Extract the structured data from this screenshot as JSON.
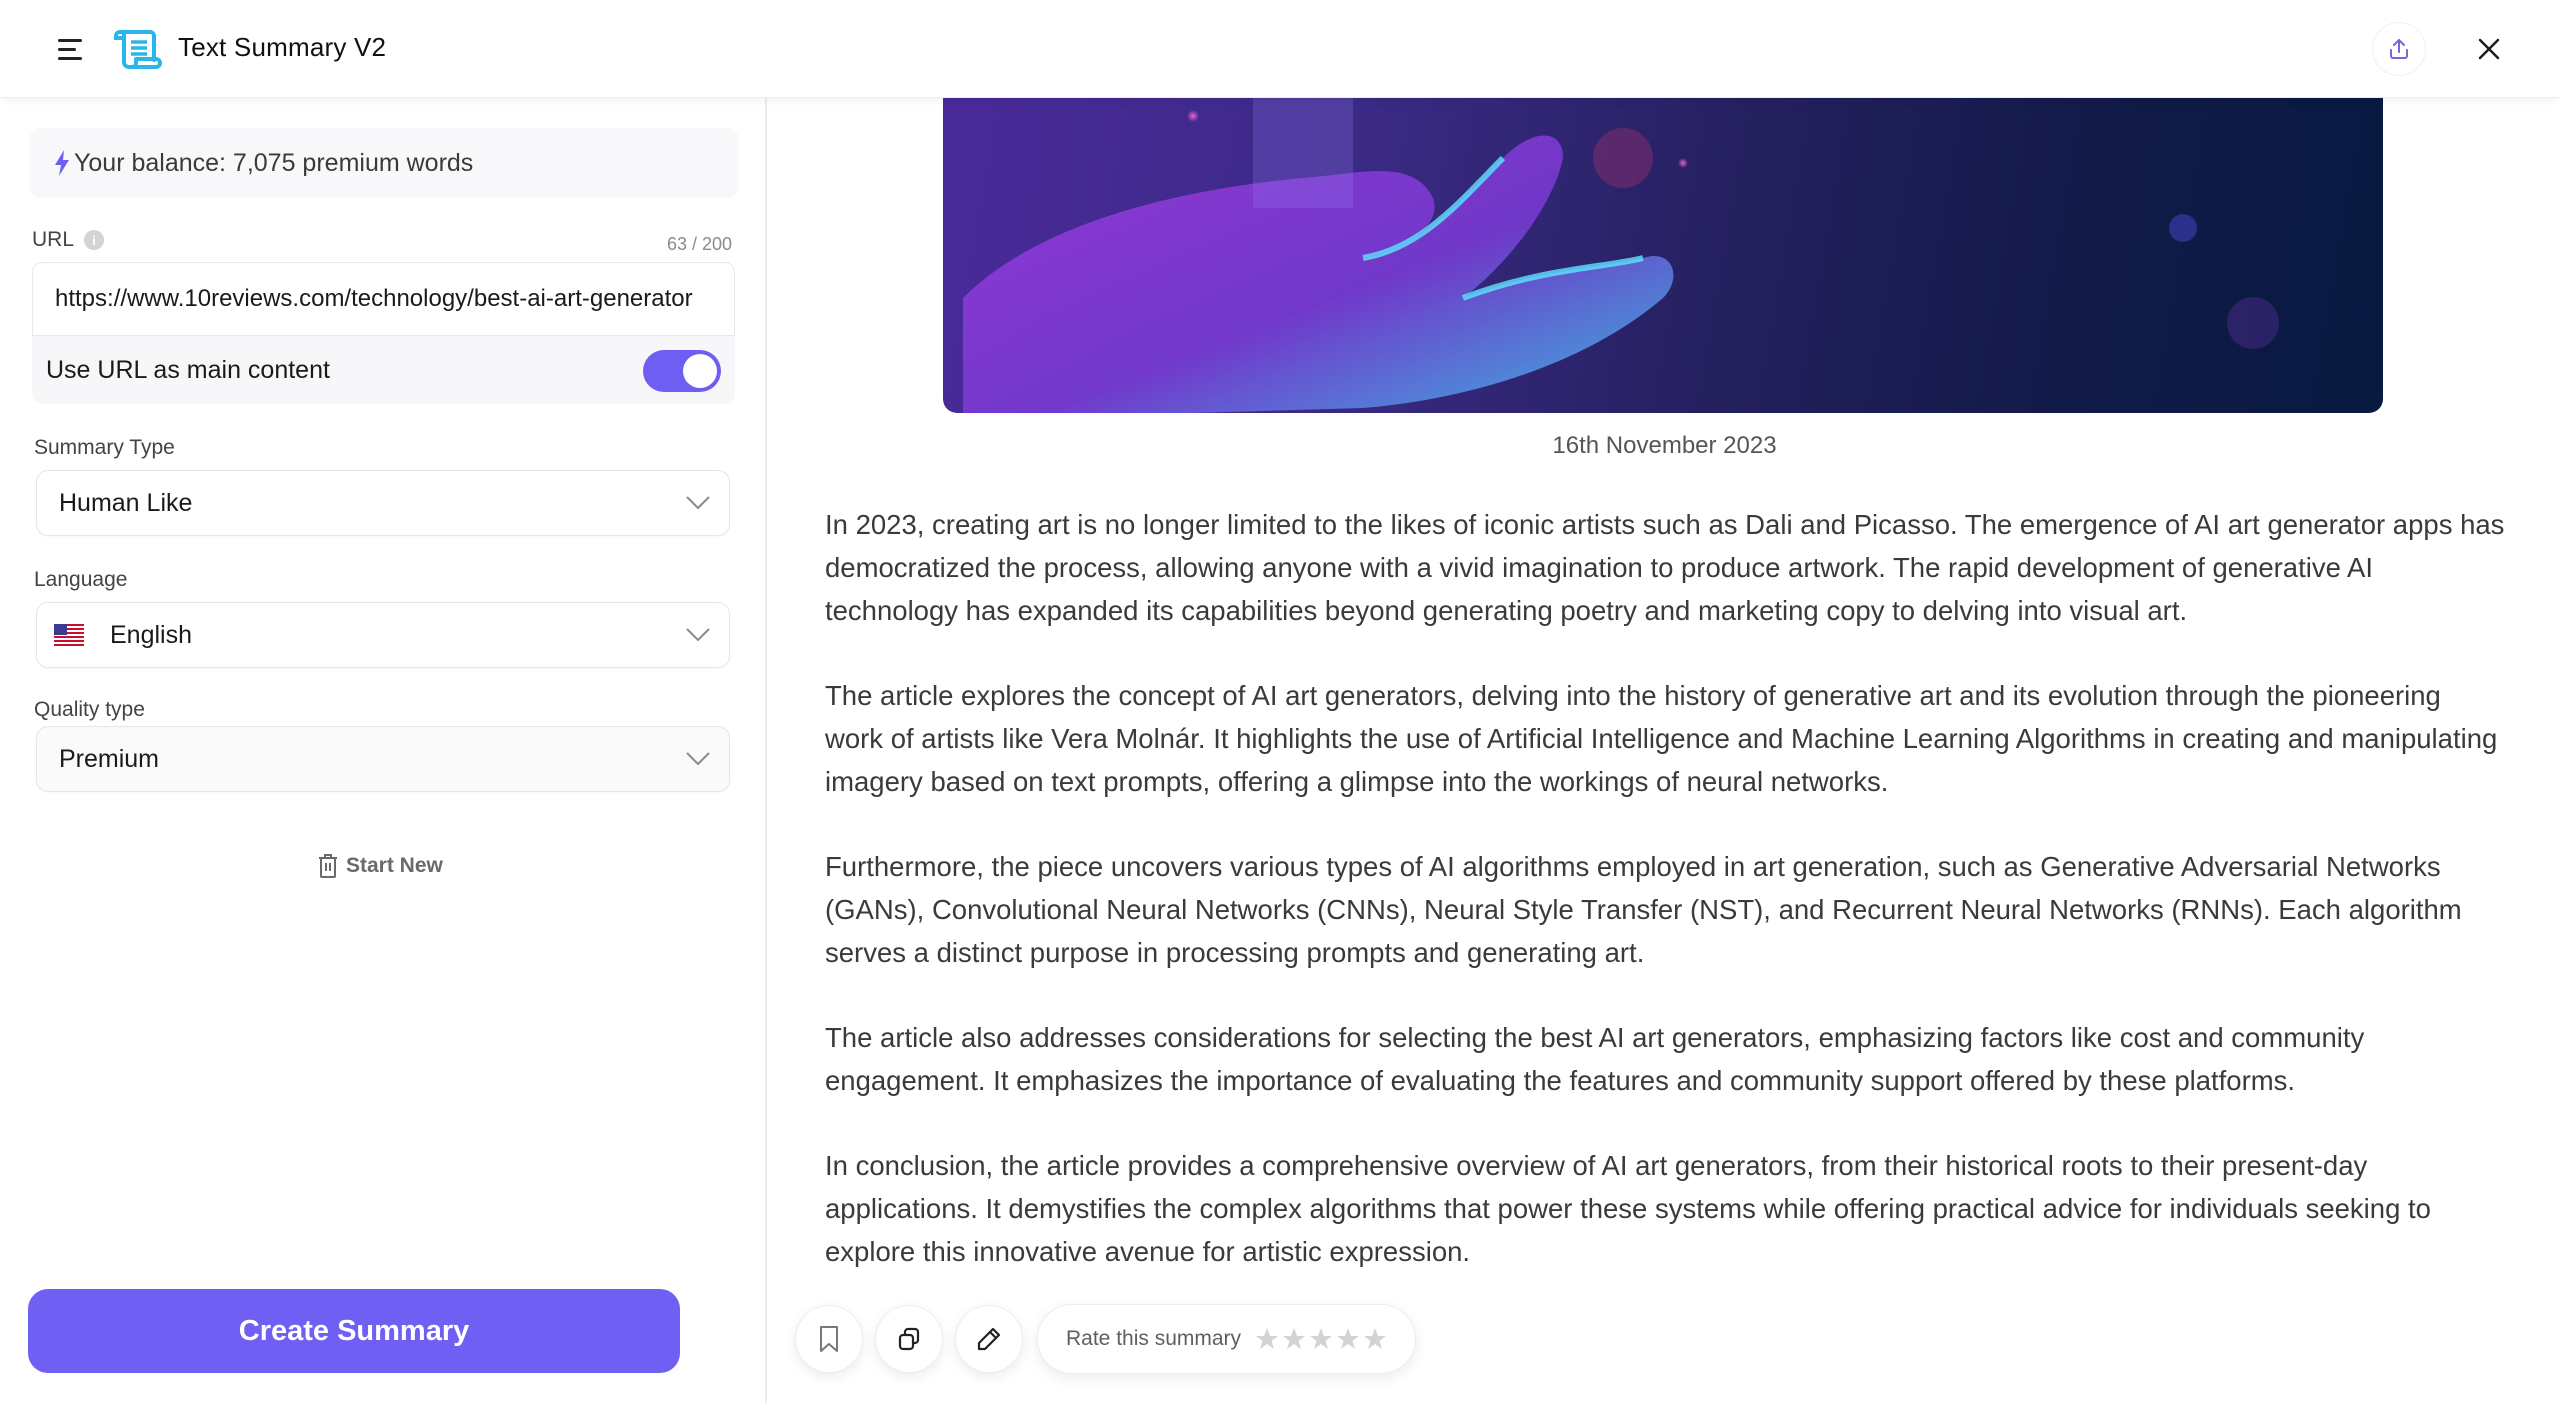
{
  "header": {
    "title": "Text Summary V2",
    "menu_icon": "hamburger-icon",
    "logo_icon": "scroll-icon",
    "share_icon": "share-upload-icon",
    "close_icon": "close-icon",
    "logo_color": "#29b6e8"
  },
  "left": {
    "balance": {
      "icon": "lightning-icon",
      "text": "Your balance: 7,075 premium words",
      "icon_color": "#6e5ff2"
    },
    "url": {
      "label": "URL",
      "counter": "63 / 200",
      "value": "https://www.10reviews.com/technology/best-ai-art-generator",
      "toggle_label": "Use URL as main content",
      "toggle_on": true
    },
    "summary_type": {
      "label": "Summary Type",
      "value": "Human Like"
    },
    "language": {
      "label": "Language",
      "value": "English",
      "flag": "us-flag-icon"
    },
    "quality_type": {
      "label": "Quality type",
      "value": "Premium"
    },
    "start_new": "Start New",
    "create_button": "Create Summary",
    "accent_color": "#6f5ff3"
  },
  "right": {
    "hero_alt": "AI art generator illustration - glowing hand",
    "date": "16th November 2023",
    "paragraphs": [
      "In 2023, creating art is no longer limited to the likes of iconic artists such as Dali and Picasso. The emergence of AI art generator apps has democratized the process, allowing anyone with a vivid imagination to produce artwork. The rapid development of generative AI technology has expanded its capabilities beyond generating poetry and marketing copy to delving into visual art.",
      "The article explores the concept of AI art generators, delving into the history of generative art and its evolution through the pioneering work of artists like Vera Molnár. It highlights the use of Artificial Intelligence and Machine Learning Algorithms in creating and manipulating imagery based on text prompts, offering a glimpse into the workings of neural networks.",
      "Furthermore, the piece uncovers various types of AI algorithms employed in art generation, such as Generative Adversarial Networks (GANs), Convolutional Neural Networks (CNNs), Neural Style Transfer (NST), and Recurrent Neural Networks (RNNs). Each algorithm serves a distinct purpose in processing prompts and generating art.",
      "The article also addresses considerations for selecting the best AI art generators, emphasizing factors like cost and community engagement. It emphasizes the importance of evaluating the features and community support offered by these platforms.",
      "In conclusion, the article provides a comprehensive overview of AI art generators, from their historical roots to their present-day applications. It demystifies the complex algorithms that power these systems while offering practical advice for individuals seeking to explore this innovative avenue for artistic expression."
    ],
    "actions": {
      "bookmark_icon": "bookmark-icon",
      "copy_icon": "copy-icon",
      "edit_icon": "pencil-icon",
      "rate_label": "Rate this summary",
      "rating": 0,
      "rating_max": 5
    }
  }
}
